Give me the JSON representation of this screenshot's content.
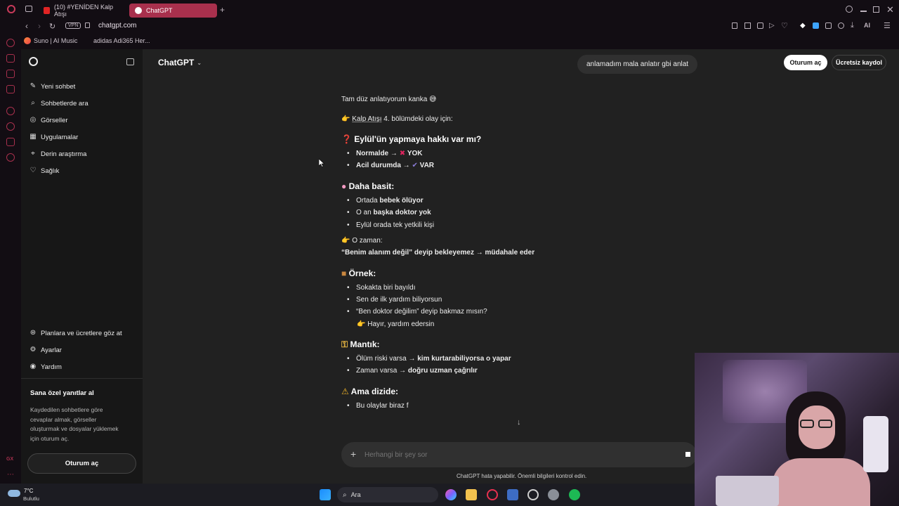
{
  "browser": {
    "tabs": [
      {
        "label": "(10) #YENİDEN Kalp Atışı",
        "active": false
      },
      {
        "label": "ChatGPT",
        "active": true
      }
    ],
    "new_tab": "+",
    "vpn": "VPN",
    "url": "chatgpt.com",
    "ai_label": "AI",
    "bookmarks": [
      "Suno | AI Music",
      "adidas Adi365 Her..."
    ],
    "gx_label": "GX"
  },
  "sidebar": {
    "items": [
      {
        "label": "Yeni sohbet",
        "icon": "edit-icon"
      },
      {
        "label": "Sohbetlerde ara",
        "icon": "search-icon"
      },
      {
        "label": "Görseller",
        "icon": "image-icon"
      },
      {
        "label": "Uygulamalar",
        "icon": "apps-icon"
      },
      {
        "label": "Derin araştırma",
        "icon": "telescope-icon"
      },
      {
        "label": "Sağlık",
        "icon": "heart-icon"
      }
    ],
    "bottom_items": [
      {
        "label": "Planlara ve ücretlere göz at",
        "icon": "plans-icon"
      },
      {
        "label": "Ayarlar",
        "icon": "gear-icon"
      },
      {
        "label": "Yardım",
        "icon": "help-icon"
      }
    ],
    "promo_title": "Sana özel yanıtlar al",
    "promo_text_1": "Kaydedilen sohbetlere göre",
    "promo_text_2": "cevaplar almak, görseller",
    "promo_text_3": "oluşturmak ve dosyalar yüklemek",
    "promo_text_4": "için oturum aç.",
    "login_button": "Oturum aç"
  },
  "header": {
    "model": "ChatGPT",
    "user_message": "anlamadım mala anlatır gbi anlat",
    "login": "Oturum aç",
    "signup": "Ücretsiz kaydol"
  },
  "response": {
    "intro": "Tam düz anlatıyorum kanka 😅",
    "ref_link": "Kalp Atışı",
    "ref_rest": " 4. bölümdeki olay için:",
    "q_heading": "Eylül'ün yapmaya hakkı var mı?",
    "b1_bold": "Normalde →",
    "b1_mark": "✖",
    "b1_tail": "YOK",
    "b2_bold": "Acil durumda →",
    "b2_mark": "✔",
    "b2_tail": "VAR",
    "simple_heading": "Daha basit:",
    "s1_pre": "Ortada ",
    "s1_bold": "bebek ölüyor",
    "s2_pre": "O an ",
    "s2_bold": "başka doktor yok",
    "s3": "Eylül orada tek yetkili kişi",
    "then": "O zaman:",
    "then_bold": "“Benim alanım değil” deyip bekleyemez → müdahale eder",
    "example_heading": "Örnek:",
    "e1": "Sokakta biri bayıldı",
    "e2": "Sen de ilk yardım biliyorsun",
    "e3": "“Ben doktor değilim” deyip bakmaz mısın?",
    "e4": "Hayır, yardım edersin",
    "logic_heading": "Mantık:",
    "l1_pre": "Ölüm riski varsa → ",
    "l1_bold": "kim kurtarabiliyorsa o yapar",
    "l2_pre": "Zaman varsa → ",
    "l2_bold": "doğru uzman çağrılır",
    "series_heading": "Ama dizide:",
    "x1": "Bu olaylar biraz f"
  },
  "composer": {
    "placeholder": "Herhangi bir şey sor",
    "disclaimer": "ChatGPT hata yapabilir. Önemli bilgileri kontrol edin."
  },
  "taskbar": {
    "temp": "7°C",
    "weather": "Bulutlu",
    "search": "Ara"
  }
}
